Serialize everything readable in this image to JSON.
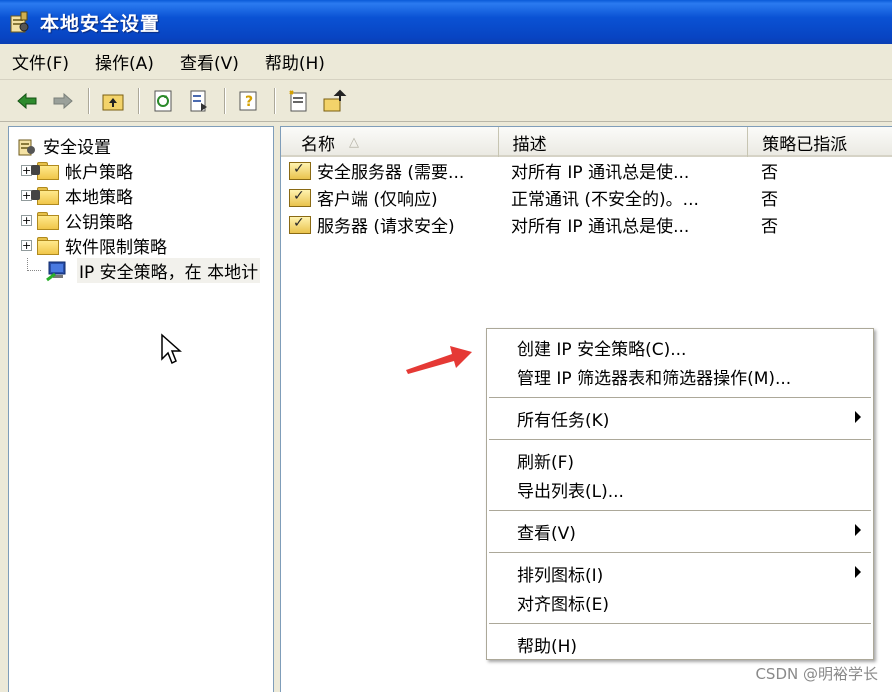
{
  "window": {
    "title": "本地安全设置"
  },
  "menu": [
    "文件(F)",
    "操作(A)",
    "查看(V)",
    "帮助(H)"
  ],
  "toolbar": {
    "icons": [
      "back-arrow-icon",
      "forward-arrow-icon",
      "up-folder-icon",
      "refresh-icon",
      "export-list-icon",
      "help-icon",
      "create-policy-icon",
      "manage-filters-icon"
    ]
  },
  "tree": {
    "root": "安全设置",
    "items": [
      {
        "label": "帐户策略"
      },
      {
        "label": "本地策略"
      },
      {
        "label": "公钥策略"
      },
      {
        "label": "软件限制策略"
      },
      {
        "label": "IP 安全策略，在 本地计"
      }
    ]
  },
  "list": {
    "columns": [
      "名称",
      "描述",
      "策略已指派"
    ],
    "sort_indicator": "△",
    "rows": [
      {
        "name": "安全服务器 (需要...",
        "desc": "对所有 IP 通讯总是使...",
        "assigned": "否"
      },
      {
        "name": "客户端 (仅响应)",
        "desc": "正常通讯 (不安全的)。...",
        "assigned": "否"
      },
      {
        "name": "服务器 (请求安全)",
        "desc": "对所有 IP 通讯总是使...",
        "assigned": "否"
      }
    ]
  },
  "context_menu": {
    "create": "创建 IP 安全策略(C)...",
    "manage": "管理 IP 筛选器表和筛选器操作(M)...",
    "all_tasks": "所有任务(K)",
    "refresh": "刷新(F)",
    "export": "导出列表(L)...",
    "view": "查看(V)",
    "arrange": "排列图标(I)",
    "align": "对齐图标(E)",
    "help": "帮助(H)"
  },
  "watermark": "CSDN @明裕学长",
  "colors": {
    "title_bar": "#0a52d4",
    "menu_bg": "#ece9d8",
    "annotation_arrow": "#e53935"
  }
}
